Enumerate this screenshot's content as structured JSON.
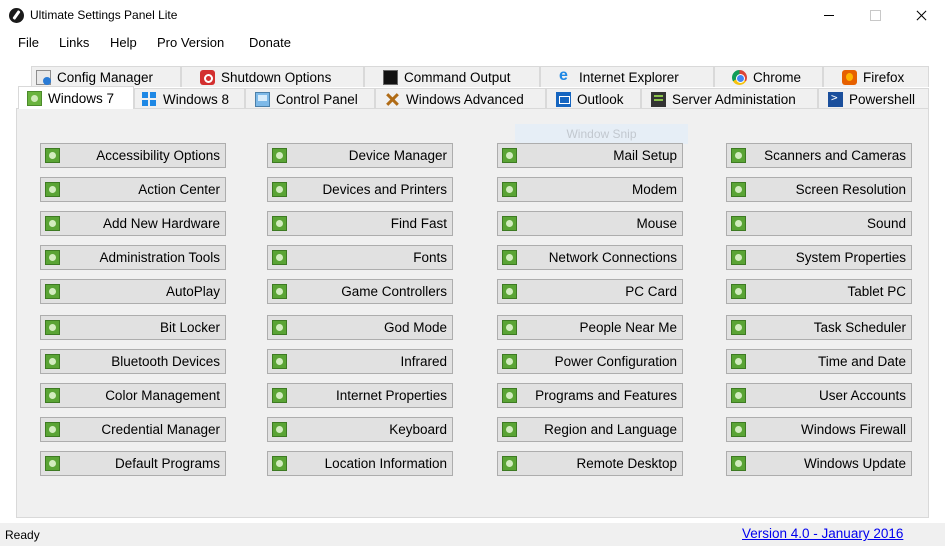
{
  "window": {
    "title": "Ultimate Settings Panel Lite",
    "icon": "pen-icon"
  },
  "menu": [
    "File",
    "Links",
    "Help",
    "Pro Version",
    "Donate"
  ],
  "tabs_top": [
    {
      "label": "Config Manager",
      "icon": "config-icon"
    },
    {
      "label": "Shutdown Options",
      "icon": "power-icon"
    },
    {
      "label": "Command Output",
      "icon": "terminal-icon"
    },
    {
      "label": "Internet Explorer",
      "icon": "ie-icon"
    },
    {
      "label": "Chrome",
      "icon": "chrome-icon"
    },
    {
      "label": "Firefox",
      "icon": "firefox-icon"
    }
  ],
  "tabs_bottom": [
    {
      "label": "Windows 7",
      "icon": "windows7-icon",
      "active": true
    },
    {
      "label": "Windows 8",
      "icon": "windows8-icon"
    },
    {
      "label": "Control Panel",
      "icon": "control-panel-icon"
    },
    {
      "label": "Windows Advanced",
      "icon": "tools-icon"
    },
    {
      "label": "Outlook",
      "icon": "mail-icon"
    },
    {
      "label": "Server Administation",
      "icon": "server-icon"
    },
    {
      "label": "Powershell",
      "icon": "powershell-icon"
    }
  ],
  "overlay": "Window Snip",
  "columns": [
    [
      "Accessibility Options",
      "Action Center",
      "Add New Hardware",
      "Administration Tools",
      "AutoPlay",
      "Bit Locker",
      "Bluetooth Devices",
      "Color Management",
      "Credential Manager",
      "Default Programs"
    ],
    [
      "Device Manager",
      "Devices and Printers",
      "Find Fast",
      "Fonts",
      "Game Controllers",
      "God Mode",
      "Infrared",
      "Internet Properties",
      "Keyboard",
      "Location Information"
    ],
    [
      "Mail Setup",
      "Modem",
      "Mouse",
      "Network Connections",
      "PC Card",
      "People Near Me",
      "Power Configuration",
      "Programs and Features",
      "Region and Language",
      "Remote Desktop"
    ],
    [
      "Scanners and Cameras",
      "Screen Resolution",
      "Sound",
      "System Properties",
      "Tablet PC",
      "Task Scheduler",
      "Time and Date",
      "User Accounts",
      "Windows Firewall",
      "Windows Update"
    ]
  ],
  "status": {
    "text": "Ready",
    "version": "Version 4.0 - January 2016"
  }
}
